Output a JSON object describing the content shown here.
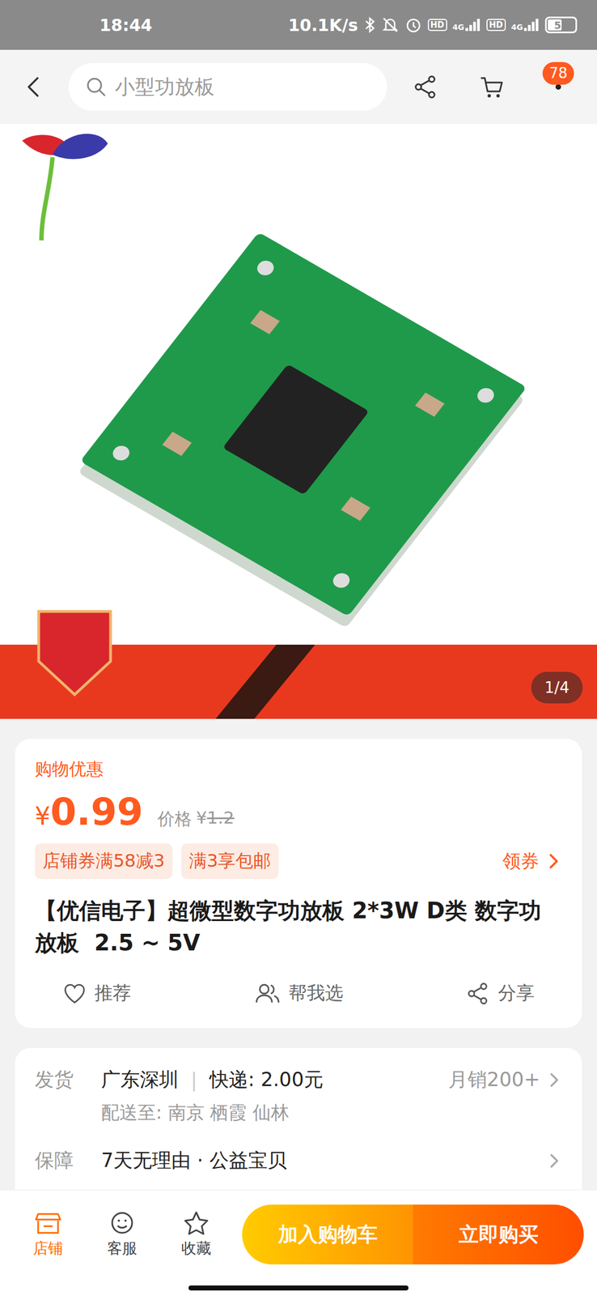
{
  "status_bar": {
    "time": "18:44",
    "speed": "10.1K/s",
    "signals": [
      {
        "hd": "HD",
        "net": "4G"
      },
      {
        "hd": "HD",
        "net": "4G"
      }
    ],
    "battery": "53",
    "battery_level": 0.53
  },
  "header": {
    "search_text": "小型功放板",
    "badge": "78"
  },
  "gallery": {
    "counter": "1/4"
  },
  "price_card": {
    "promo_label": "购物优惠",
    "currency": "¥",
    "price": "0.99",
    "orig_label": "价格",
    "orig_currency": "¥",
    "orig_price": "1.2",
    "tags": [
      "店铺券满58减3",
      "满3享包邮"
    ],
    "coupon_link": "领券",
    "title": "【优信电子】超微型数字功放板 2*3W D类 数字功放板  2.5 ~ 5V",
    "actions": [
      {
        "label": "推荐",
        "kind": "heart"
      },
      {
        "label": "帮我选",
        "kind": "people"
      },
      {
        "label": "分享",
        "kind": "share"
      }
    ]
  },
  "details": [
    {
      "label": "发货",
      "value": "广东深圳",
      "separator": "|",
      "extra": "快递: 2.00元",
      "right": "月销200+",
      "sub": "配送至: 南京 栖霞 仙林"
    },
    {
      "label": "保障",
      "value": "7天无理由 · 公益宝贝"
    }
  ],
  "bottom_bar": {
    "icons": [
      {
        "label": "店铺",
        "kind": "store",
        "selected": true
      },
      {
        "label": "客服",
        "kind": "service",
        "selected": false
      },
      {
        "label": "收藏",
        "kind": "star",
        "selected": false
      }
    ],
    "buttons": [
      "加入购物车",
      "立即购买"
    ]
  }
}
